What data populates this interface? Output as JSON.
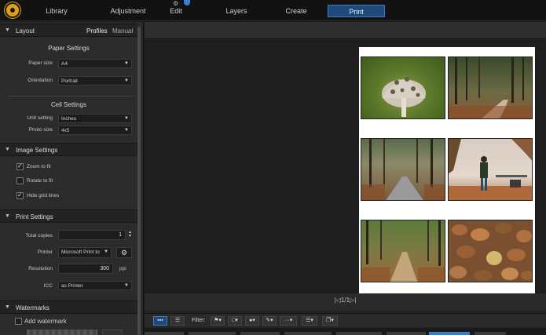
{
  "tabs": [
    {
      "label": "Library"
    },
    {
      "label": "Adjustment"
    },
    {
      "label": "Edit"
    },
    {
      "label": "Layers"
    },
    {
      "label": "Create"
    },
    {
      "label": "Print"
    }
  ],
  "active_tab": "Print",
  "left": {
    "layout": {
      "title": "Layout",
      "profiles_label": "Profiles",
      "manual_label": "Manual",
      "paper_settings_title": "Paper Settings",
      "paper_size_label": "Paper size",
      "paper_size_value": "A4",
      "orientation_label": "Orientation",
      "orientation_value": "Portrait",
      "cell_settings_title": "Cell Settings",
      "unit_setting_label": "Unit setting",
      "unit_setting_value": "Inches",
      "photo_size_label": "Photo size",
      "photo_size_value": "4x5"
    },
    "image_settings": {
      "title": "Image Settings",
      "zoom_to_fit": "Zoom to fit",
      "zoom_to_fit_checked": true,
      "rotate_to_fit": "Rotate to fit",
      "rotate_to_fit_checked": false,
      "hide_grid_lines": "Hide grid lines",
      "hide_grid_lines_checked": true
    },
    "print_settings": {
      "title": "Print Settings",
      "total_copies_label": "Total copies",
      "total_copies_value": "1",
      "printer_label": "Printer",
      "printer_value": "Microsoft Print to",
      "resolution_label": "Resolution",
      "resolution_value": "300",
      "resolution_unit": "ppi",
      "icc_label": "ICC",
      "icc_value": "as Printer"
    },
    "watermarks": {
      "title": "Watermarks",
      "add_watermark": "Add watermark",
      "add_watermark_checked": false
    }
  },
  "pager": {
    "text": "|◁1/1▷|"
  },
  "filmbar": {
    "filter_label": "Filter:"
  },
  "photos": [
    {
      "name": "mushroom"
    },
    {
      "name": "forest-path-1"
    },
    {
      "name": "forest-road"
    },
    {
      "name": "person-in-park"
    },
    {
      "name": "leaf-path"
    },
    {
      "name": "autumn-leaves"
    }
  ]
}
